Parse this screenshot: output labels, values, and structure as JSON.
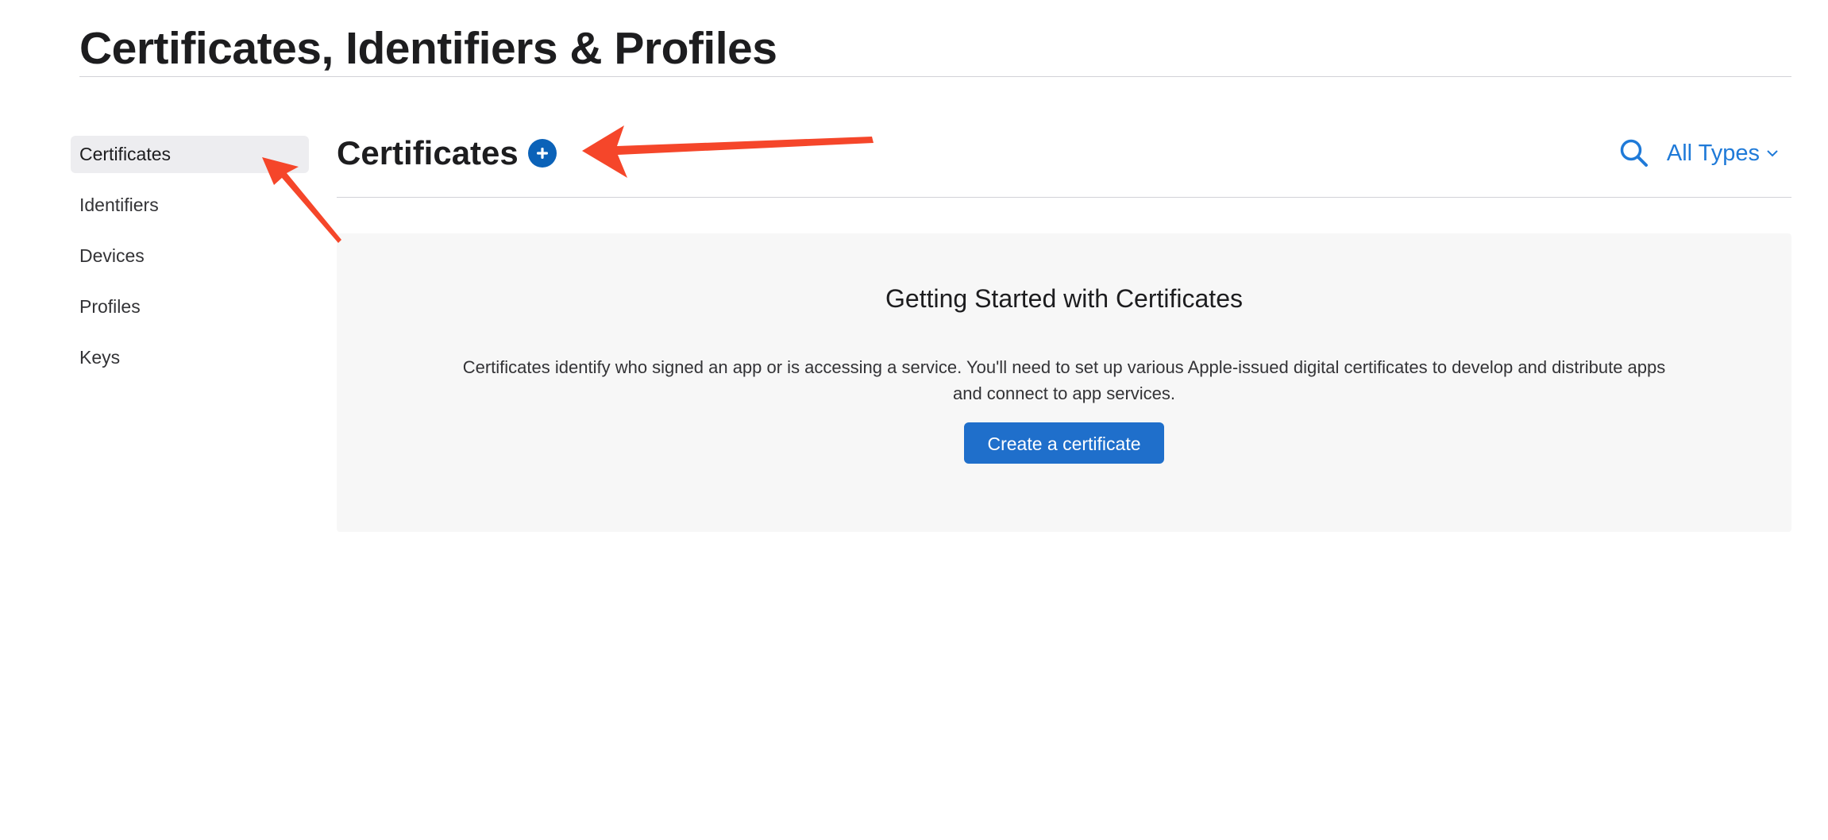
{
  "page": {
    "title": "Certificates, Identifiers & Profiles"
  },
  "sidebar": {
    "items": [
      {
        "label": "Certificates",
        "active": true
      },
      {
        "label": "Identifiers",
        "active": false
      },
      {
        "label": "Devices",
        "active": false
      },
      {
        "label": "Profiles",
        "active": false
      },
      {
        "label": "Keys",
        "active": false
      }
    ]
  },
  "main": {
    "section_title": "Certificates",
    "add_icon": "plus-circle-icon",
    "search_icon": "search-icon",
    "filter_label": "All Types",
    "filter_icon": "chevron-down-icon",
    "empty_state": {
      "title": "Getting Started with Certificates",
      "description": "Certificates identify who signed an app or is accessing a service. You'll need to set up various Apple-issued digital certificates to develop and distribute apps and connect to app services.",
      "button_label": "Create a certificate"
    }
  },
  "colors": {
    "accent": "#1f7ad8",
    "button": "#1f6fcb",
    "add_button": "#0b62b8",
    "annotation_arrow": "#f5462a",
    "panel_background": "#f7f7f7",
    "sidebar_active": "#ededf0"
  }
}
